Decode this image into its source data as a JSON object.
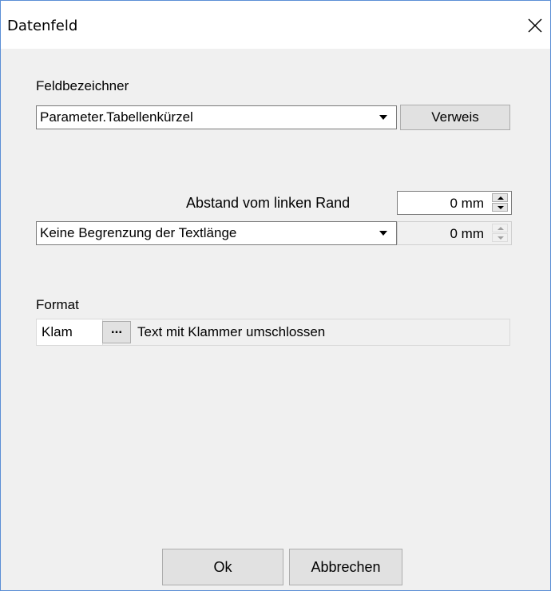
{
  "window": {
    "title": "Datenfeld",
    "close_glyph": "close-icon"
  },
  "feldbezeichner": {
    "label": "Feldbezeichner",
    "value": "Parameter.Tabellenkürzel",
    "verweis_label": "Verweis"
  },
  "abstand": {
    "label": "Abstand vom linken Rand",
    "value": "0 mm"
  },
  "begrenzung": {
    "value": "Keine Begrenzung der Textlänge",
    "spin_value": "0 mm"
  },
  "format": {
    "label": "Format",
    "code": "Klam",
    "browse_label": "...",
    "description": "Text mit Klammer umschlossen"
  },
  "buttons": {
    "ok": "Ok",
    "cancel": "Abbrechen"
  },
  "colors": {
    "window_border": "#5b8fd6",
    "dialog_bg": "#f0f0f0",
    "button_bg": "#e1e1e1"
  }
}
